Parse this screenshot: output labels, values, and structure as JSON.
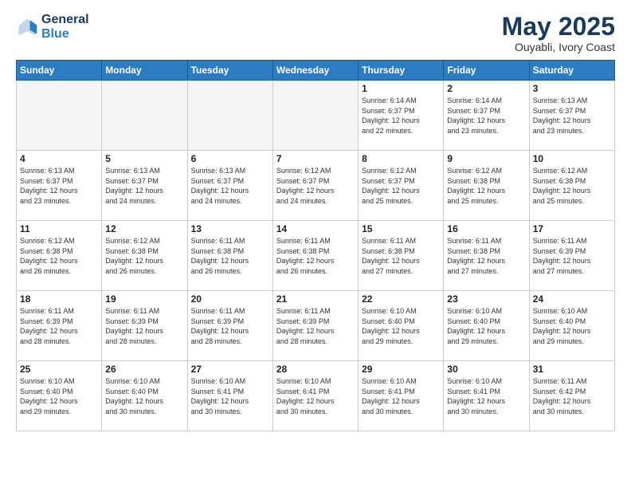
{
  "header": {
    "logo_line1": "General",
    "logo_line2": "Blue",
    "month_title": "May 2025",
    "location": "Ouyabli, Ivory Coast"
  },
  "weekdays": [
    "Sunday",
    "Monday",
    "Tuesday",
    "Wednesday",
    "Thursday",
    "Friday",
    "Saturday"
  ],
  "weeks": [
    [
      {
        "day": "",
        "info": ""
      },
      {
        "day": "",
        "info": ""
      },
      {
        "day": "",
        "info": ""
      },
      {
        "day": "",
        "info": ""
      },
      {
        "day": "1",
        "info": "Sunrise: 6:14 AM\nSunset: 6:37 PM\nDaylight: 12 hours\nand 22 minutes."
      },
      {
        "day": "2",
        "info": "Sunrise: 6:14 AM\nSunset: 6:37 PM\nDaylight: 12 hours\nand 23 minutes."
      },
      {
        "day": "3",
        "info": "Sunrise: 6:13 AM\nSunset: 6:37 PM\nDaylight: 12 hours\nand 23 minutes."
      }
    ],
    [
      {
        "day": "4",
        "info": "Sunrise: 6:13 AM\nSunset: 6:37 PM\nDaylight: 12 hours\nand 23 minutes."
      },
      {
        "day": "5",
        "info": "Sunrise: 6:13 AM\nSunset: 6:37 PM\nDaylight: 12 hours\nand 24 minutes."
      },
      {
        "day": "6",
        "info": "Sunrise: 6:13 AM\nSunset: 6:37 PM\nDaylight: 12 hours\nand 24 minutes."
      },
      {
        "day": "7",
        "info": "Sunrise: 6:12 AM\nSunset: 6:37 PM\nDaylight: 12 hours\nand 24 minutes."
      },
      {
        "day": "8",
        "info": "Sunrise: 6:12 AM\nSunset: 6:37 PM\nDaylight: 12 hours\nand 25 minutes."
      },
      {
        "day": "9",
        "info": "Sunrise: 6:12 AM\nSunset: 6:38 PM\nDaylight: 12 hours\nand 25 minutes."
      },
      {
        "day": "10",
        "info": "Sunrise: 6:12 AM\nSunset: 6:38 PM\nDaylight: 12 hours\nand 25 minutes."
      }
    ],
    [
      {
        "day": "11",
        "info": "Sunrise: 6:12 AM\nSunset: 6:38 PM\nDaylight: 12 hours\nand 26 minutes."
      },
      {
        "day": "12",
        "info": "Sunrise: 6:12 AM\nSunset: 6:38 PM\nDaylight: 12 hours\nand 26 minutes."
      },
      {
        "day": "13",
        "info": "Sunrise: 6:11 AM\nSunset: 6:38 PM\nDaylight: 12 hours\nand 26 minutes."
      },
      {
        "day": "14",
        "info": "Sunrise: 6:11 AM\nSunset: 6:38 PM\nDaylight: 12 hours\nand 26 minutes."
      },
      {
        "day": "15",
        "info": "Sunrise: 6:11 AM\nSunset: 6:38 PM\nDaylight: 12 hours\nand 27 minutes."
      },
      {
        "day": "16",
        "info": "Sunrise: 6:11 AM\nSunset: 6:38 PM\nDaylight: 12 hours\nand 27 minutes."
      },
      {
        "day": "17",
        "info": "Sunrise: 6:11 AM\nSunset: 6:39 PM\nDaylight: 12 hours\nand 27 minutes."
      }
    ],
    [
      {
        "day": "18",
        "info": "Sunrise: 6:11 AM\nSunset: 6:39 PM\nDaylight: 12 hours\nand 28 minutes."
      },
      {
        "day": "19",
        "info": "Sunrise: 6:11 AM\nSunset: 6:39 PM\nDaylight: 12 hours\nand 28 minutes."
      },
      {
        "day": "20",
        "info": "Sunrise: 6:11 AM\nSunset: 6:39 PM\nDaylight: 12 hours\nand 28 minutes."
      },
      {
        "day": "21",
        "info": "Sunrise: 6:11 AM\nSunset: 6:39 PM\nDaylight: 12 hours\nand 28 minutes."
      },
      {
        "day": "22",
        "info": "Sunrise: 6:10 AM\nSunset: 6:40 PM\nDaylight: 12 hours\nand 29 minutes."
      },
      {
        "day": "23",
        "info": "Sunrise: 6:10 AM\nSunset: 6:40 PM\nDaylight: 12 hours\nand 29 minutes."
      },
      {
        "day": "24",
        "info": "Sunrise: 6:10 AM\nSunset: 6:40 PM\nDaylight: 12 hours\nand 29 minutes."
      }
    ],
    [
      {
        "day": "25",
        "info": "Sunrise: 6:10 AM\nSunset: 6:40 PM\nDaylight: 12 hours\nand 29 minutes."
      },
      {
        "day": "26",
        "info": "Sunrise: 6:10 AM\nSunset: 6:40 PM\nDaylight: 12 hours\nand 30 minutes."
      },
      {
        "day": "27",
        "info": "Sunrise: 6:10 AM\nSunset: 6:41 PM\nDaylight: 12 hours\nand 30 minutes."
      },
      {
        "day": "28",
        "info": "Sunrise: 6:10 AM\nSunset: 6:41 PM\nDaylight: 12 hours\nand 30 minutes."
      },
      {
        "day": "29",
        "info": "Sunrise: 6:10 AM\nSunset: 6:41 PM\nDaylight: 12 hours\nand 30 minutes."
      },
      {
        "day": "30",
        "info": "Sunrise: 6:10 AM\nSunset: 6:41 PM\nDaylight: 12 hours\nand 30 minutes."
      },
      {
        "day": "31",
        "info": "Sunrise: 6:11 AM\nSunset: 6:42 PM\nDaylight: 12 hours\nand 30 minutes."
      }
    ]
  ]
}
